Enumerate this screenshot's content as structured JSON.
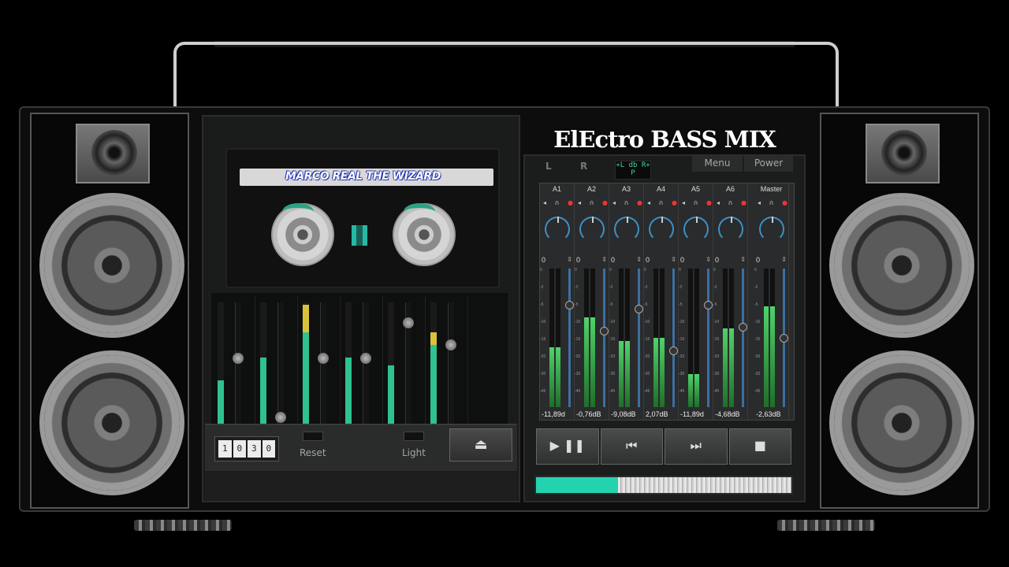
{
  "title": "ELECTRO BASS MIX",
  "title_display": "ElEctro BASS MIX",
  "cassette": {
    "label": "MARCO REAL THE WIZARD",
    "brand": ""
  },
  "deck": {
    "counter": [
      "1",
      "0",
      "3",
      "0"
    ],
    "reset_label": "Reset",
    "light_label": "Light",
    "eject_icon": "eject-icon",
    "strips": [
      {
        "level": 0.38,
        "peak": 0,
        "fader": 0.55
      },
      {
        "level": 0.56,
        "peak": 0,
        "fader": 0.05
      },
      {
        "level": 0.76,
        "peak": 0.22,
        "fader": 0.55
      },
      {
        "level": 0.56,
        "peak": 0,
        "fader": 0.55
      },
      {
        "level": 0.5,
        "peak": 0,
        "fader": 0.85
      },
      {
        "level": 0.66,
        "peak": 0.1,
        "fader": 0.66
      }
    ]
  },
  "mixer": {
    "L": "L",
    "R": "R",
    "lcd_top": "+L db R+",
    "lcd_bottom": "P",
    "menu_label": "Menu",
    "power_label": "Power",
    "scale": [
      "0",
      "-2",
      "-5",
      "-10",
      "-15",
      "-20",
      "-30",
      "-45"
    ],
    "channels": [
      {
        "name": "A1",
        "pan": "0",
        "level": 0.43,
        "fader": 0.75,
        "db": "-11,89d"
      },
      {
        "name": "A2",
        "pan": "0",
        "level": 0.65,
        "fader": 0.55,
        "db": "-0,76dB"
      },
      {
        "name": "A3",
        "pan": "0",
        "level": 0.48,
        "fader": 0.72,
        "db": "-9,08dB"
      },
      {
        "name": "A4",
        "pan": "0",
        "level": 0.5,
        "fader": 0.4,
        "db": "2,07dB"
      },
      {
        "name": "A5",
        "pan": "0",
        "level": 0.24,
        "fader": 0.75,
        "db": "-11,89d"
      },
      {
        "name": "A6",
        "pan": "0",
        "level": 0.57,
        "fader": 0.58,
        "db": "-4,68dB"
      },
      {
        "name": "Master",
        "pan": "0",
        "level": 0.73,
        "fader": 0.5,
        "db": "-2,63dB"
      }
    ],
    "transport": [
      "▶ ❚❚",
      "⏮",
      "⏭",
      "■"
    ],
    "transport_icons": [
      "play-pause-icon",
      "previous-icon",
      "next-icon",
      "stop-icon"
    ],
    "progress": 0.32
  },
  "colors": {
    "meter_green": "#2fc28e",
    "peak_yellow": "#d9c23a",
    "accent_teal": "#23d3b0",
    "knob_blue": "#3d8fc4"
  }
}
